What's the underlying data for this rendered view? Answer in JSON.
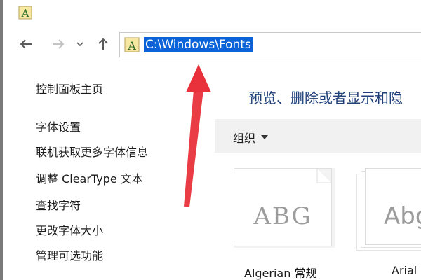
{
  "window": {
    "title_icon": "font-folder-icon"
  },
  "nav": {
    "back_icon": "arrow-left-icon",
    "forward_icon": "arrow-right-icon",
    "recent_icon": "chevron-down-icon",
    "up_icon": "arrow-up-icon"
  },
  "address_bar": {
    "icon": "font-folder-icon",
    "path": "C:\\Windows\\Fonts"
  },
  "sidebar": {
    "items": [
      {
        "label": "控制面板主页"
      },
      {
        "label": "字体设置"
      },
      {
        "label": "联机获取更多字体信息"
      },
      {
        "label": "调整 ClearType 文本"
      },
      {
        "label": "查找字符"
      },
      {
        "label": "更改字体大小"
      },
      {
        "label": "管理可选功能"
      }
    ]
  },
  "main": {
    "heading": "预览、删除或者显示和隐",
    "toolbar": {
      "organize_label": "组织"
    },
    "fonts": [
      {
        "sample": "ABG",
        "name": "Algerian 常规"
      },
      {
        "sample": "Abg",
        "name": "Arial"
      }
    ]
  },
  "colors": {
    "selection": "#0a64d8",
    "heading": "#1e3f78",
    "annotation_arrow": "#e8313a"
  }
}
